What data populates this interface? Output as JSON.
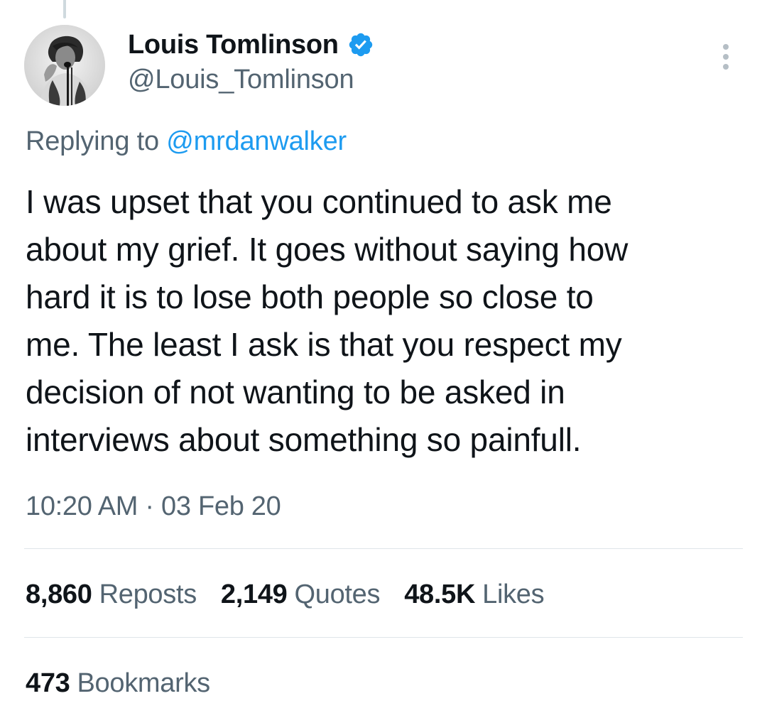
{
  "author": {
    "display_name": "Louis Tomlinson",
    "handle": "@Louis_Tomlinson",
    "verified": true,
    "verified_color": "#1d9bf0",
    "avatar_icon": "profile-photo-icon"
  },
  "more_icon": "more-options-icon",
  "reply_context": {
    "prefix": "Replying to",
    "mention": "@mrdanwalker"
  },
  "tweet": {
    "lines": [
      "I was upset that you continued to ask me",
      "about my grief. It goes without saying how",
      "hard it is to lose both people so close to",
      "me. The least I ask is that you respect my",
      "decision of not wanting to be asked in",
      "interviews about something so painfull."
    ]
  },
  "timestamp": "10:20 AM · 03 Feb 20",
  "stats": {
    "reposts": {
      "count": "8,860",
      "label": "Reposts"
    },
    "quotes": {
      "count": "2,149",
      "label": "Quotes"
    },
    "likes": {
      "count": "48.5K",
      "label": "Likes"
    },
    "bookmarks": {
      "count": "473",
      "label": "Bookmarks"
    }
  },
  "colors": {
    "text_primary": "#0f1419",
    "text_secondary": "#536471",
    "link": "#1d9bf0",
    "divider": "#dfe5e9"
  }
}
